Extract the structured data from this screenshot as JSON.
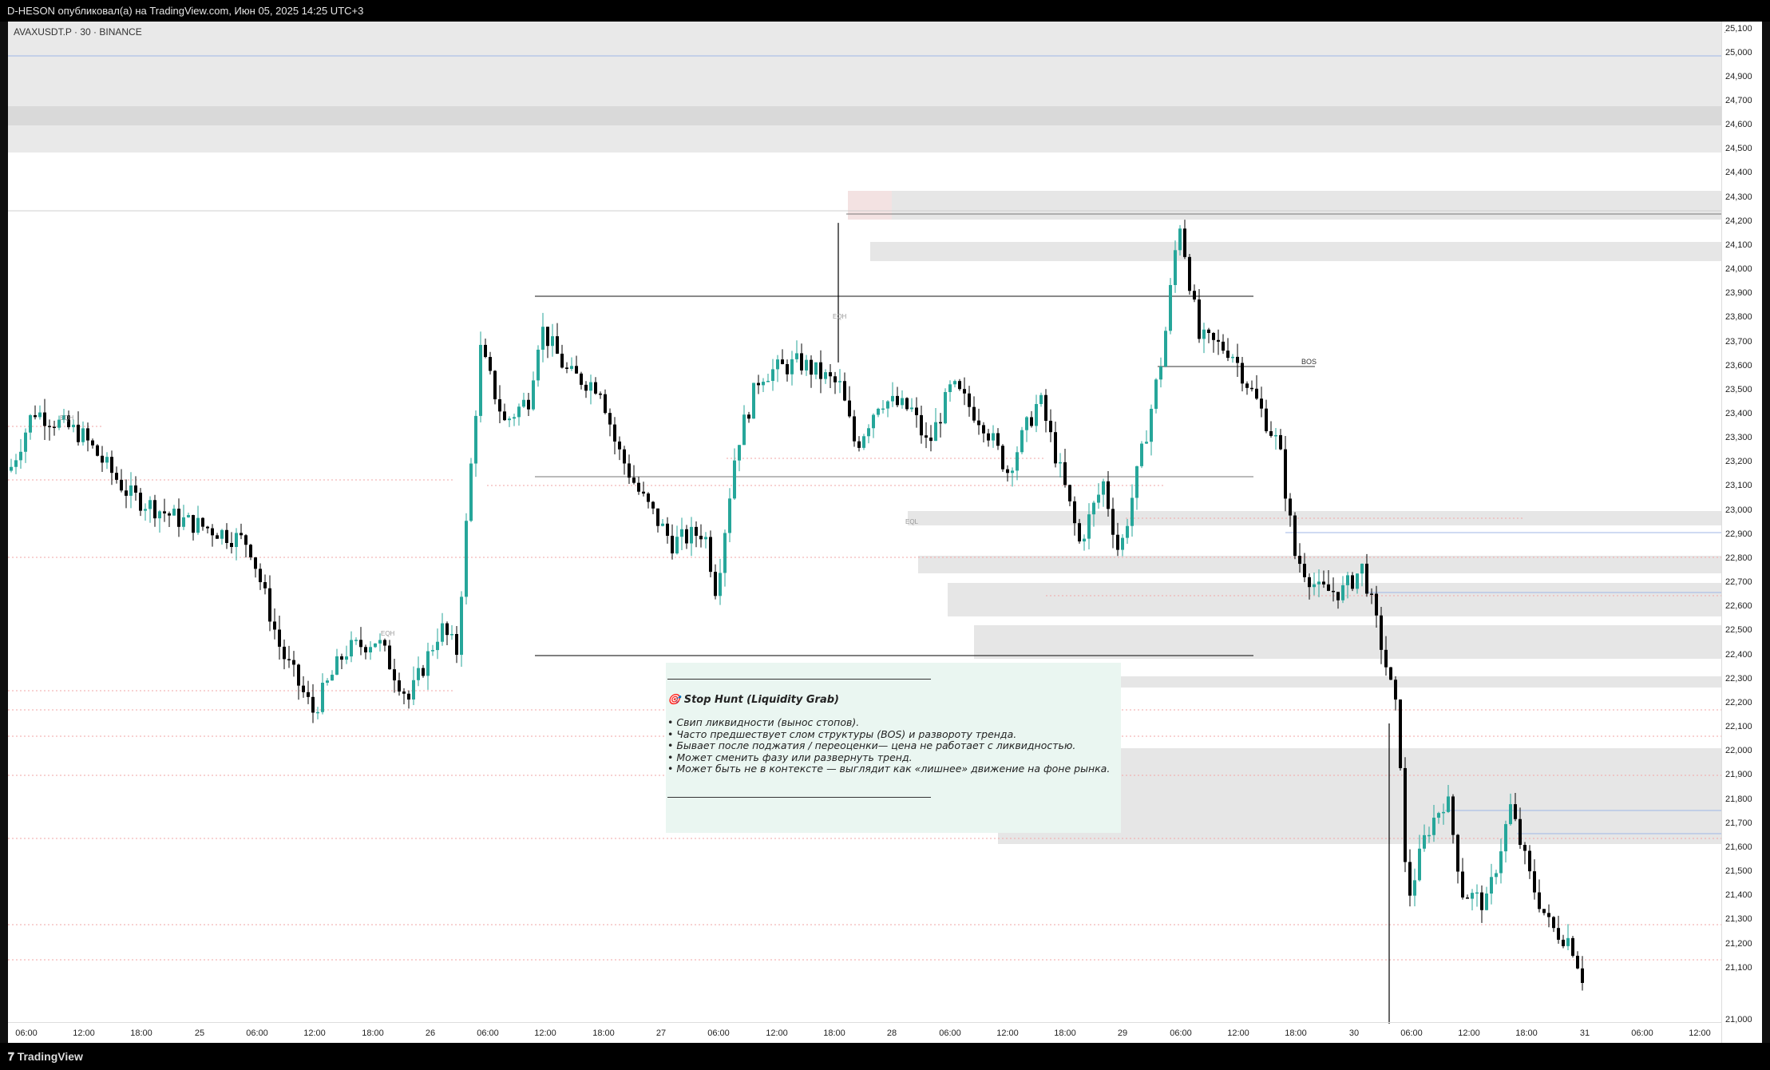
{
  "header": {
    "publish_line": "D-HESON опубликовал(а) на TradingView.com, Июн 05, 2025 14:25 UTC+3"
  },
  "symbol_info": {
    "text": "AVAXUSDT.P · 30 · BINANCE"
  },
  "price_axis": {
    "labels": [
      "25,100",
      "25,000",
      "24,900",
      "24,700",
      "24,600",
      "24,500",
      "24,400",
      "24,300",
      "24,200",
      "24,100",
      "24,000",
      "23,900",
      "23,800",
      "23,700",
      "23,600",
      "23,500",
      "23,400",
      "23,300",
      "23,200",
      "23,100",
      "23,000",
      "22,900",
      "22,800",
      "22,700",
      "22,600",
      "22,500",
      "22,400",
      "22,300",
      "22,200",
      "22,100",
      "22,000",
      "21,900",
      "21,800",
      "21,700",
      "21,600",
      "21,500",
      "21,400",
      "21,300",
      "21,200",
      "21,100",
      "21,000"
    ],
    "dot": "·"
  },
  "time_axis": {
    "labels": [
      "06:00",
      "12:00",
      "18:00",
      "25",
      "06:00",
      "12:00",
      "18:00",
      "26",
      "06:00",
      "12:00",
      "18:00",
      "27",
      "06:00",
      "12:00",
      "18:00",
      "28",
      "06:00",
      "12:00",
      "18:00",
      "29",
      "06:00",
      "12:00",
      "18:00",
      "30",
      "06:00",
      "12:00",
      "18:00",
      "31",
      "06:00",
      "12:00"
    ]
  },
  "annotations": {
    "eqh_label": "EQH",
    "eql_label": "EQL",
    "bos_label": "BOS"
  },
  "note": {
    "rule": "________________________________________________",
    "title": "🎯 Stop Hunt (Liquidity Grab)",
    "lines": [
      "• Свип ликвидности (вынос стопов).",
      "• Часто предшествует слом структуры (BOS) и развороту тренда.",
      "• Бывает после поджатия / переоценки— цена не работает с ликвидностью.",
      "• Может сменить фазу или развернуть тренд.",
      "• Может быть не в контексте — выглядит как «лишнее» движение на фоне рынка."
    ]
  },
  "footer": {
    "brand": "TradingView"
  },
  "colors": {
    "up": "#26a69a",
    "down": "#000000",
    "zone": "#e6e6e6",
    "zone_red": "#f3e2e2",
    "blue_line": "#9fb6e6",
    "red_dotted": "#f2a6a6"
  }
}
